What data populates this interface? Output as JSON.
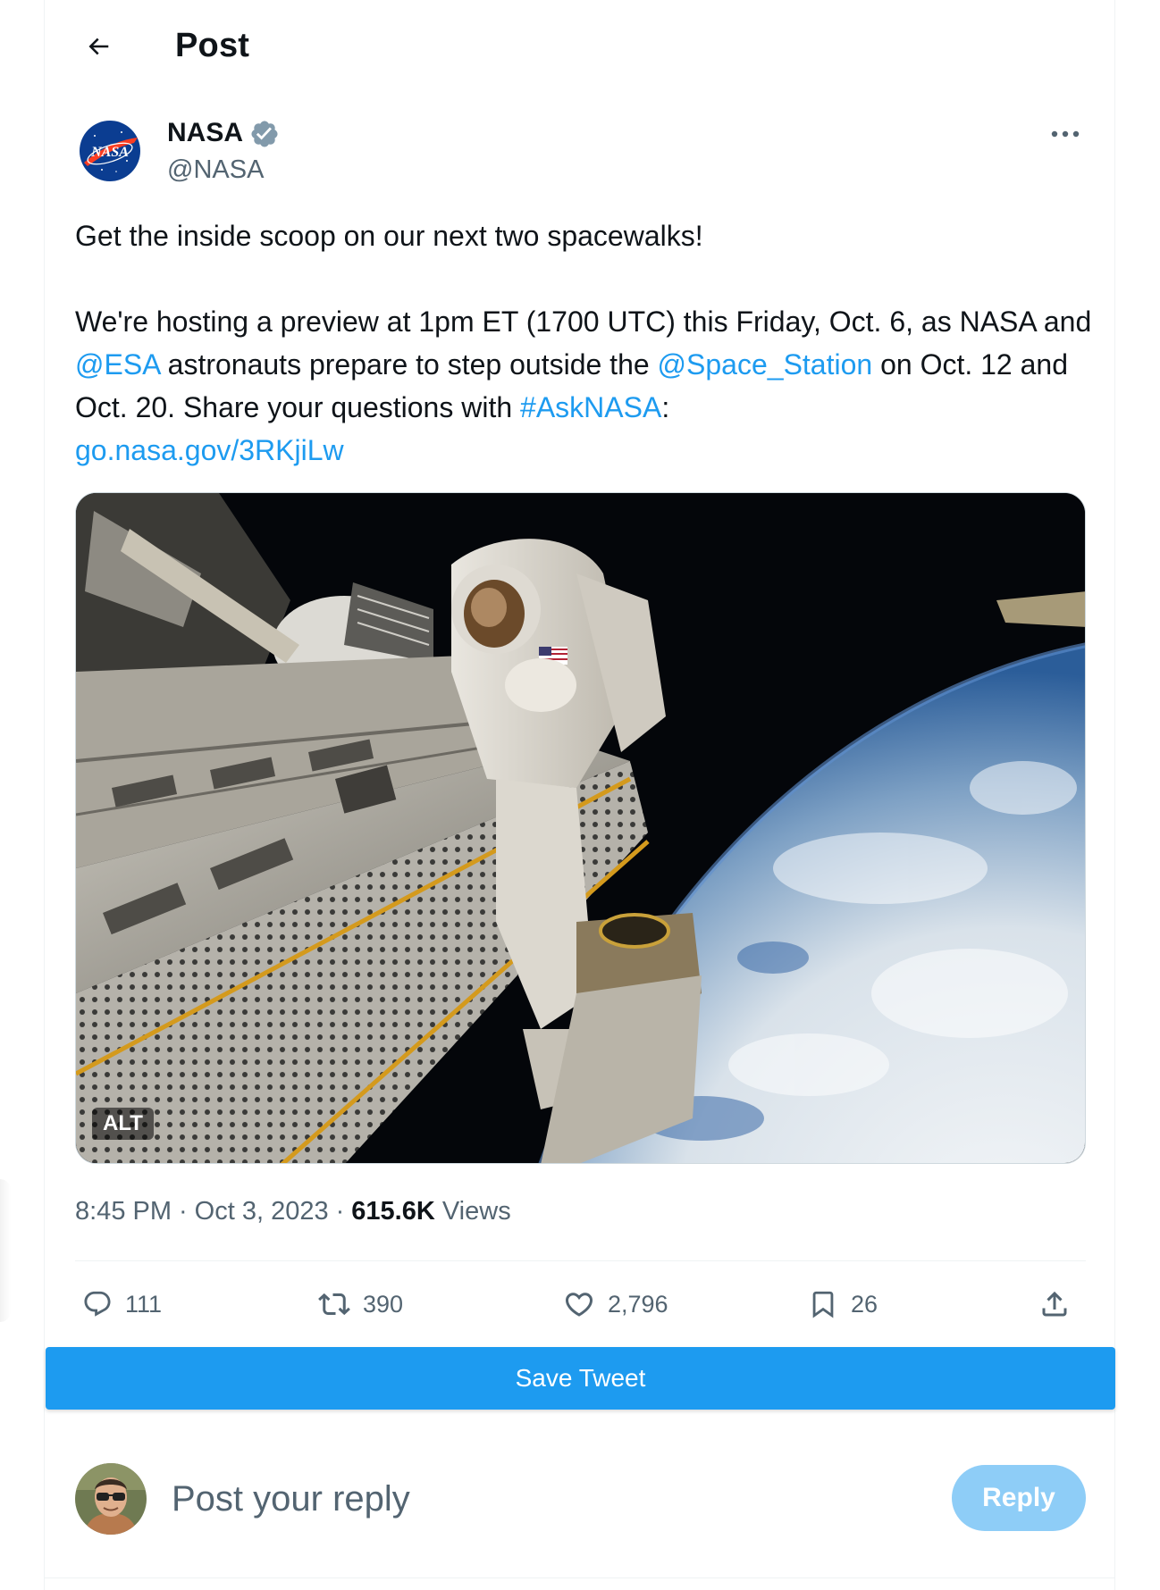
{
  "header": {
    "title": "Post",
    "back_icon": "arrow-left-icon"
  },
  "author": {
    "name": "NASA",
    "handle": "@NASA",
    "verified": true,
    "verified_color": "#829aab",
    "avatar_icon": "nasa-meatball-logo",
    "avatar_logo_text": "NASA"
  },
  "tweet": {
    "line1": "Get the inside scoop on our next two spacewalks!",
    "p2_a": "We're hosting a preview at 1pm ET (1700 UTC) this Friday, Oct. 6, as NASA and ",
    "mention_esa": "@ESA",
    "p2_b": " astronauts prepare to step outside the ",
    "mention_station": "@Space_Station",
    "p2_c": " on Oct. 12 and Oct. 20. Share your questions with ",
    "hashtag": "#AskNASA",
    "p2_d": ":",
    "link": "go.nasa.gov/3RKjiLw",
    "link_color": "#1d9bf0"
  },
  "media": {
    "alt_badge": "ALT"
  },
  "meta": {
    "time": "8:45 PM",
    "separator": "·",
    "date": "Oct 3, 2023",
    "views_count": "615.6K",
    "views_label": "Views"
  },
  "actions": {
    "replies": "111",
    "retweets": "390",
    "likes": "2,796",
    "bookmarks": "26"
  },
  "save_bar": {
    "label": "Save Tweet",
    "color": "#1d9bf0"
  },
  "composer": {
    "placeholder": "Post your reply",
    "reply_button": "Reply",
    "reply_button_color": "#8ecdf7"
  }
}
